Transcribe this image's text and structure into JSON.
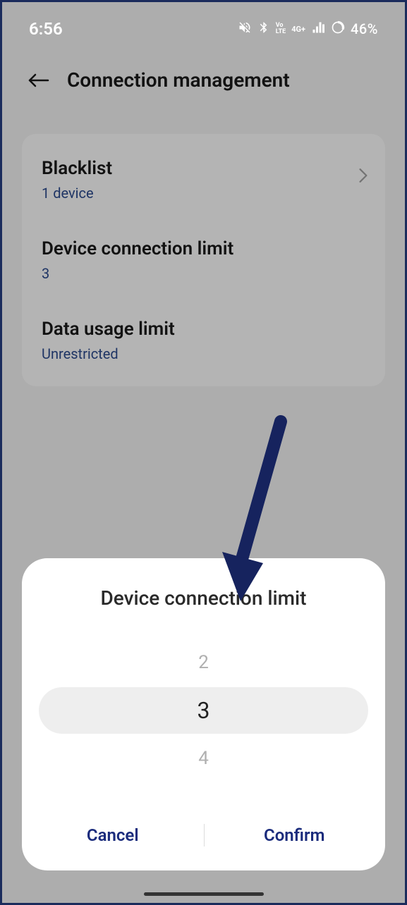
{
  "statusBar": {
    "time": "6:56",
    "battery": "46%"
  },
  "header": {
    "title": "Connection management"
  },
  "settings": {
    "blacklist": {
      "title": "Blacklist",
      "subtitle": "1 device"
    },
    "deviceLimit": {
      "title": "Device connection limit",
      "subtitle": "3"
    },
    "dataLimit": {
      "title": "Data usage limit",
      "subtitle": "Unrestricted"
    }
  },
  "dialog": {
    "title": "Device connection limit",
    "options": {
      "prev": "2",
      "current": "3",
      "next": "4"
    },
    "cancelLabel": "Cancel",
    "confirmLabel": "Confirm"
  }
}
